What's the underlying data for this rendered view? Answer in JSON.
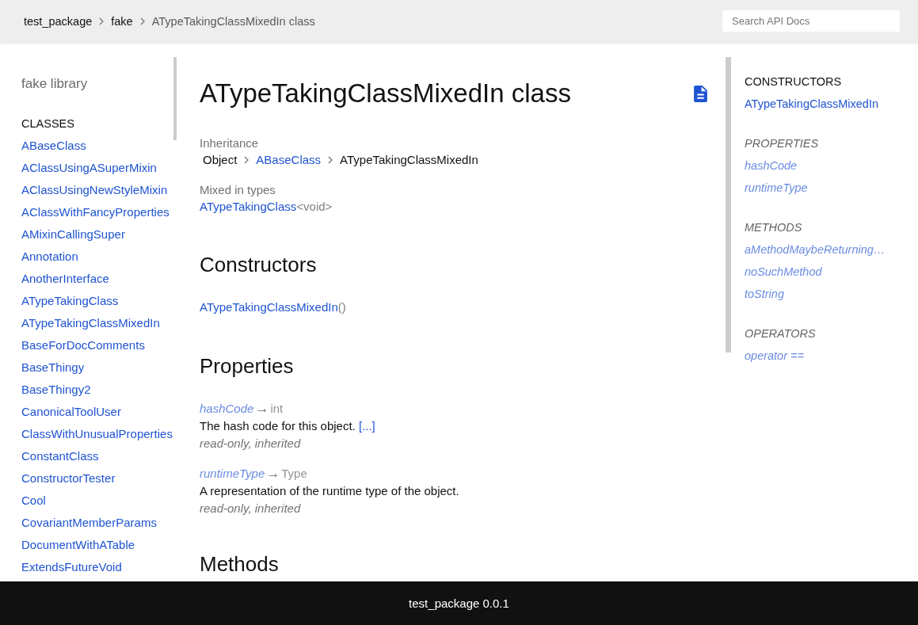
{
  "header": {
    "breadcrumbs": [
      {
        "label": "test_package",
        "kind": "link"
      },
      {
        "label": "fake",
        "kind": "link"
      },
      {
        "label": "ATypeTakingClassMixedIn class",
        "kind": "current"
      }
    ],
    "search": {
      "placeholder": "Search API Docs"
    }
  },
  "left_sidebar": {
    "title": "fake library",
    "sections": [
      {
        "heading": "CLASSES",
        "items": [
          "ABaseClass",
          "AClassUsingASuperMixin",
          "AClassUsingNewStyleMixin",
          "AClassWithFancyProperties",
          "AMixinCallingSuper",
          "Annotation",
          "AnotherInterface",
          "ATypeTakingClass",
          "ATypeTakingClassMixedIn",
          "BaseForDocComments",
          "BaseThingy",
          "BaseThingy2",
          "CanonicalToolUser",
          "ClassWithUnusualProperties",
          "ConstantClass",
          "ConstructorTester",
          "Cool",
          "CovariantMemberParams",
          "DocumentWithATable",
          "ExtendsFutureVoid"
        ]
      }
    ]
  },
  "main": {
    "title": "ATypeTakingClassMixedIn class",
    "inheritance": {
      "label": "Inheritance",
      "chain": [
        {
          "name": "Object",
          "kind": "plain"
        },
        {
          "name": "ABaseClass",
          "kind": "link"
        },
        {
          "name": "ATypeTakingClassMixedIn",
          "kind": "plain"
        }
      ]
    },
    "mixed_in": {
      "label": "Mixed in types",
      "types": [
        {
          "name": "ATypeTakingClass",
          "type_args": "<void>"
        }
      ]
    },
    "sections": [
      {
        "heading": "Constructors",
        "constructors": [
          {
            "name": "ATypeTakingClassMixedIn",
            "params": "()"
          }
        ]
      },
      {
        "heading": "Properties",
        "properties": [
          {
            "name": "hashCode",
            "inherited": true,
            "arrow": "→",
            "type": "int",
            "description": "The hash code for this object.",
            "more": "[...]",
            "features": "read-only, inherited"
          },
          {
            "name": "runtimeType",
            "inherited": true,
            "arrow": "→",
            "type": "Type",
            "description": "A representation of the runtime type of the object.",
            "features": "read-only, inherited"
          }
        ]
      },
      {
        "heading": "Methods"
      }
    ]
  },
  "right_sidebar": {
    "sections": [
      {
        "heading": "CONSTRUCTORS",
        "inherited": false,
        "items": [
          "ATypeTakingClassMixedIn"
        ]
      },
      {
        "heading": "PROPERTIES",
        "inherited": true,
        "items": [
          "hashCode",
          "runtimeType"
        ]
      },
      {
        "heading": "METHODS",
        "inherited": true,
        "items": [
          "aMethodMaybeReturning…",
          "noSuchMethod",
          "toString"
        ]
      },
      {
        "heading": "OPERATORS",
        "inherited": true,
        "items": [
          "operator =="
        ]
      }
    ]
  },
  "footer": {
    "text": "test_package 0.0.1"
  }
}
